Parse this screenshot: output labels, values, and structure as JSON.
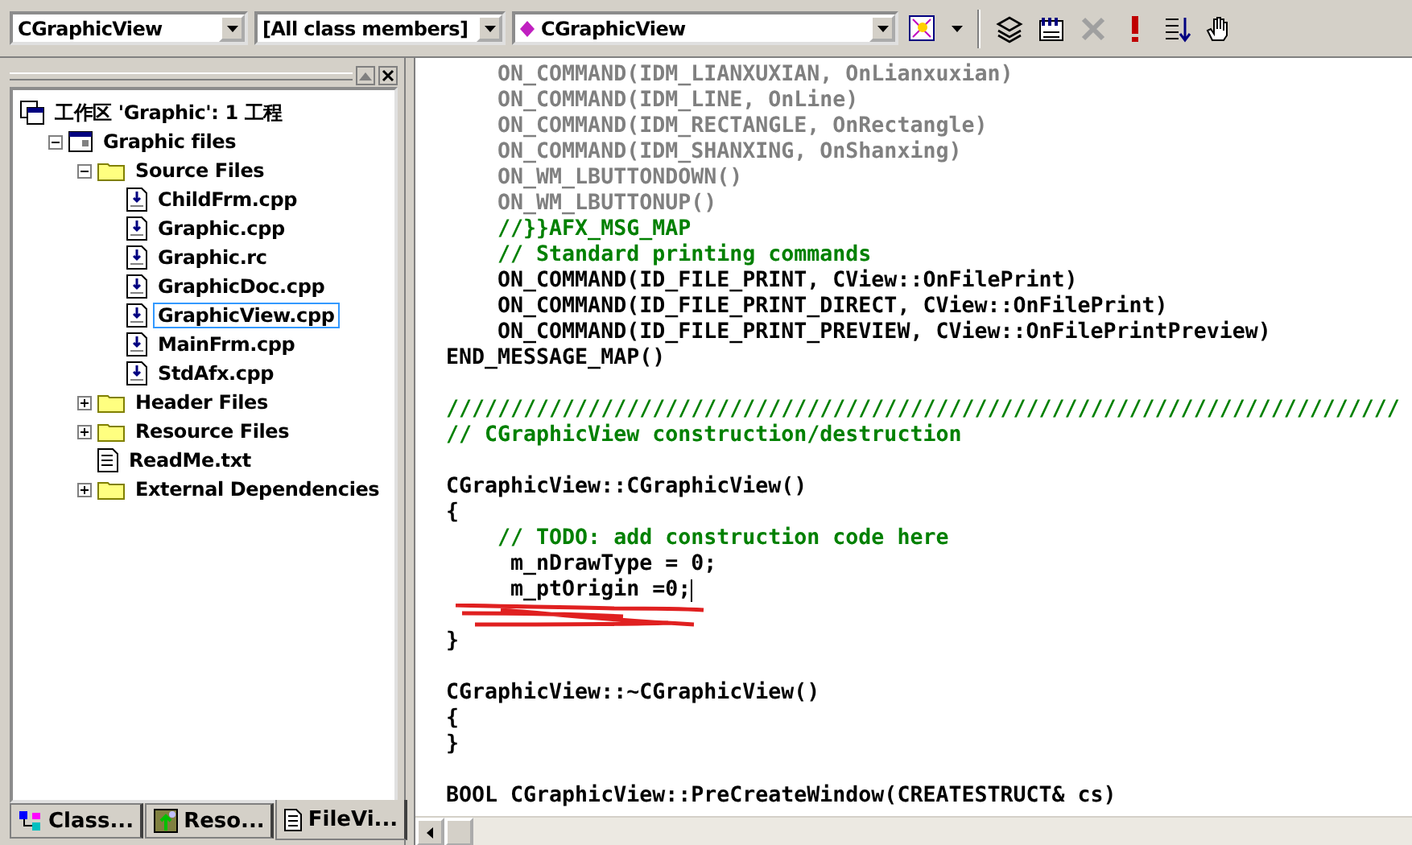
{
  "toolbar": {
    "class_combo": "CGraphicView",
    "filter_combo": "[All class members]",
    "member_combo": "CGraphicView"
  },
  "workspace": {
    "tree": [
      {
        "label": "工作区 'Graphic': 1 工程",
        "kind": "workspace",
        "selected": false,
        "children": [
          {
            "label": "Graphic files",
            "kind": "project",
            "expanded": true,
            "selected": false,
            "children": [
              {
                "label": "Source Files",
                "kind": "folder",
                "expanded": true,
                "selected": false,
                "children": [
                  {
                    "label": "ChildFrm.cpp",
                    "kind": "source",
                    "selected": false
                  },
                  {
                    "label": "Graphic.cpp",
                    "kind": "source",
                    "selected": false
                  },
                  {
                    "label": "Graphic.rc",
                    "kind": "source",
                    "selected": false
                  },
                  {
                    "label": "GraphicDoc.cpp",
                    "kind": "source",
                    "selected": false
                  },
                  {
                    "label": "GraphicView.cpp",
                    "kind": "source",
                    "selected": true
                  },
                  {
                    "label": "MainFrm.cpp",
                    "kind": "source",
                    "selected": false
                  },
                  {
                    "label": "StdAfx.cpp",
                    "kind": "source",
                    "selected": false
                  }
                ]
              },
              {
                "label": "Header Files",
                "kind": "folder",
                "expanded": false,
                "selected": false
              },
              {
                "label": "Resource Files",
                "kind": "folder",
                "expanded": false,
                "selected": false
              },
              {
                "label": "ReadMe.txt",
                "kind": "text",
                "selected": false
              },
              {
                "label": "External Dependencies",
                "kind": "folder",
                "expanded": false,
                "selected": false
              }
            ]
          }
        ]
      }
    ],
    "tabs": [
      {
        "label": "Class...",
        "kind": "class",
        "selected": false
      },
      {
        "label": "Reso...",
        "kind": "resource",
        "selected": false
      },
      {
        "label": "FileVi...",
        "kind": "file",
        "selected": true
      }
    ]
  },
  "editor": {
    "lines": [
      {
        "kind": "gray",
        "text": "    ON_COMMAND(IDM_LIANXUXIAN, OnLianxuxian)"
      },
      {
        "kind": "gray",
        "text": "    ON_COMMAND(IDM_LINE, OnLine)"
      },
      {
        "kind": "gray",
        "text": "    ON_COMMAND(IDM_RECTANGLE, OnRectangle)"
      },
      {
        "kind": "gray",
        "text": "    ON_COMMAND(IDM_SHANXING, OnShanxing)"
      },
      {
        "kind": "gray",
        "text": "    ON_WM_LBUTTONDOWN()"
      },
      {
        "kind": "gray",
        "text": "    ON_WM_LBUTTONUP()"
      },
      {
        "kind": "comment",
        "text": "    //}}AFX_MSG_MAP"
      },
      {
        "kind": "comment",
        "text": "    // Standard printing commands"
      },
      {
        "kind": "code",
        "text": "    ON_COMMAND(ID_FILE_PRINT, CView::OnFilePrint)"
      },
      {
        "kind": "code",
        "text": "    ON_COMMAND(ID_FILE_PRINT_DIRECT, CView::OnFilePrint)"
      },
      {
        "kind": "code",
        "text": "    ON_COMMAND(ID_FILE_PRINT_PREVIEW, CView::OnFilePrintPreview)"
      },
      {
        "kind": "code",
        "text": "END_MESSAGE_MAP()"
      },
      {
        "kind": "blank"
      },
      {
        "kind": "comment",
        "text": "//////////////////////////////////////////////////////////////////////////"
      },
      {
        "kind": "comment",
        "text": "// CGraphicView construction/destruction"
      },
      {
        "kind": "blank"
      },
      {
        "kind": "code",
        "text": "CGraphicView::CGraphicView()"
      },
      {
        "kind": "code",
        "text": "{"
      },
      {
        "kind": "comment",
        "text": "    // TODO: add construction code here"
      },
      {
        "kind": "code",
        "text": "     m_nDrawType = 0;"
      },
      {
        "kind": "code",
        "text": "     m_ptOrigin =0;",
        "cursor": true
      },
      {
        "kind": "scribble"
      },
      {
        "kind": "code",
        "text": "}"
      },
      {
        "kind": "blank"
      },
      {
        "kind": "code",
        "text": "CGraphicView::~CGraphicView()"
      },
      {
        "kind": "code",
        "text": "{"
      },
      {
        "kind": "code",
        "text": "}"
      },
      {
        "kind": "blank"
      },
      {
        "kind": "code",
        "text": "BOOL CGraphicView::PreCreateWindow(CREATESTRUCT& cs)"
      }
    ]
  }
}
